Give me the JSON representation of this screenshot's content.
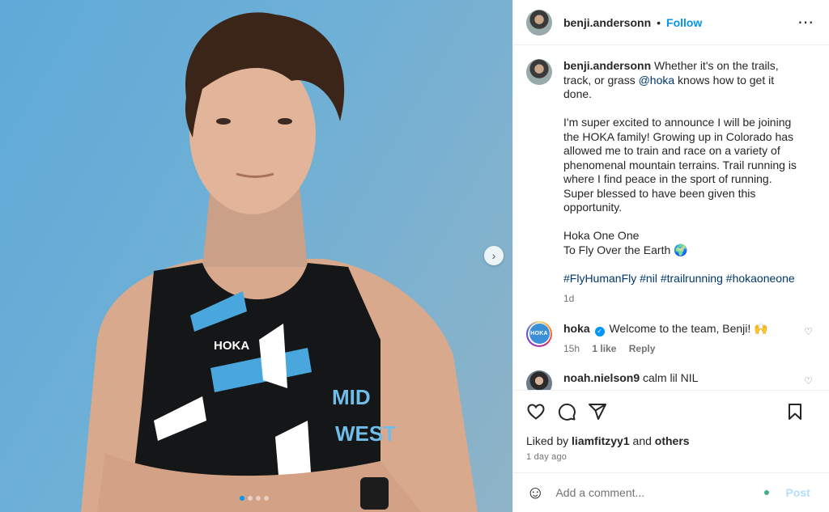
{
  "header": {
    "username": "benji.andersonn",
    "separator": "•",
    "follow_label": "Follow",
    "more_icon": "⋯"
  },
  "caption": {
    "username": "benji.andersonn",
    "line1_pre": "Whether it's on the trails, track, or grass ",
    "mention": "@hoka",
    "line1_post": " knows how to get it done.",
    "para2": "I'm super excited to announce I will be joining the HOKA family! Growing up in Colorado has allowed me to train and race on a variety of phenomenal mountain terrains. Trail running is where I find peace in the sport of running. Super blessed to have been given this opportunity.",
    "para3a": "Hoka One One",
    "para3b": "To Fly Over the Earth 🌍",
    "hashtags": [
      "#FlyHumanFly",
      "#nil",
      "#trailrunning",
      "#hokaoneone"
    ],
    "time": "1d"
  },
  "comments": [
    {
      "username": "hoka",
      "verified": true,
      "text": "Welcome to the team, Benji! 🙌",
      "time": "15h",
      "likes": "1 like",
      "reply_label": "Reply",
      "avatar_text": "HOKA"
    },
    {
      "username": "noah.nielson9",
      "verified": false,
      "text": "calm lil NIL"
    }
  ],
  "actions": {
    "liked_by_prefix": "Liked by ",
    "liked_by_user": "liamfitzyy1",
    "liked_by_and": " and ",
    "liked_by_others": "others",
    "posted_ago": "1 day ago"
  },
  "add_comment": {
    "placeholder": "Add a comment...",
    "post_label": "Post"
  },
  "carousel": {
    "total_slides": 4,
    "active_slide": 1,
    "next_icon": "›"
  },
  "colors": {
    "accent": "#0095f6",
    "link": "#00376b",
    "muted": "#737373",
    "post_disabled": "#b2dffc"
  }
}
